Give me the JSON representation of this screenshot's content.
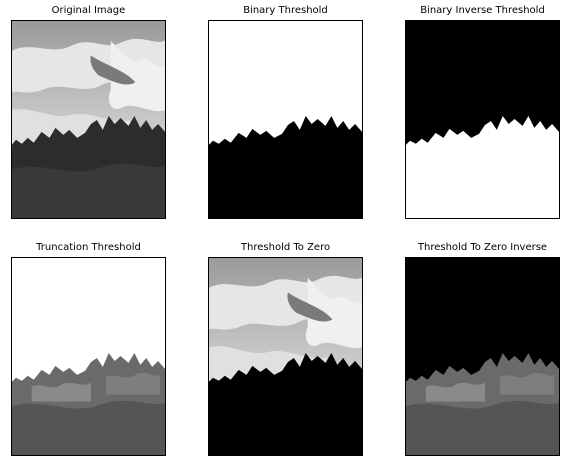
{
  "panels": [
    {
      "title": "Original Image"
    },
    {
      "title": "Binary Threshold"
    },
    {
      "title": "Binary Inverse Threshold"
    },
    {
      "title": "Truncation Threshold"
    },
    {
      "title": "Threshold To Zero"
    },
    {
      "title": "Threshold To Zero Inverse"
    }
  ],
  "colors": {
    "sky_light": "#d9d9d9",
    "sky_mid": "#aaaaaa",
    "sky_dark": "#7a7a7a",
    "trees_dark": "#2a2a2a",
    "trees_mid": "#5a5a5a",
    "black": "#000000",
    "white": "#ffffff"
  }
}
